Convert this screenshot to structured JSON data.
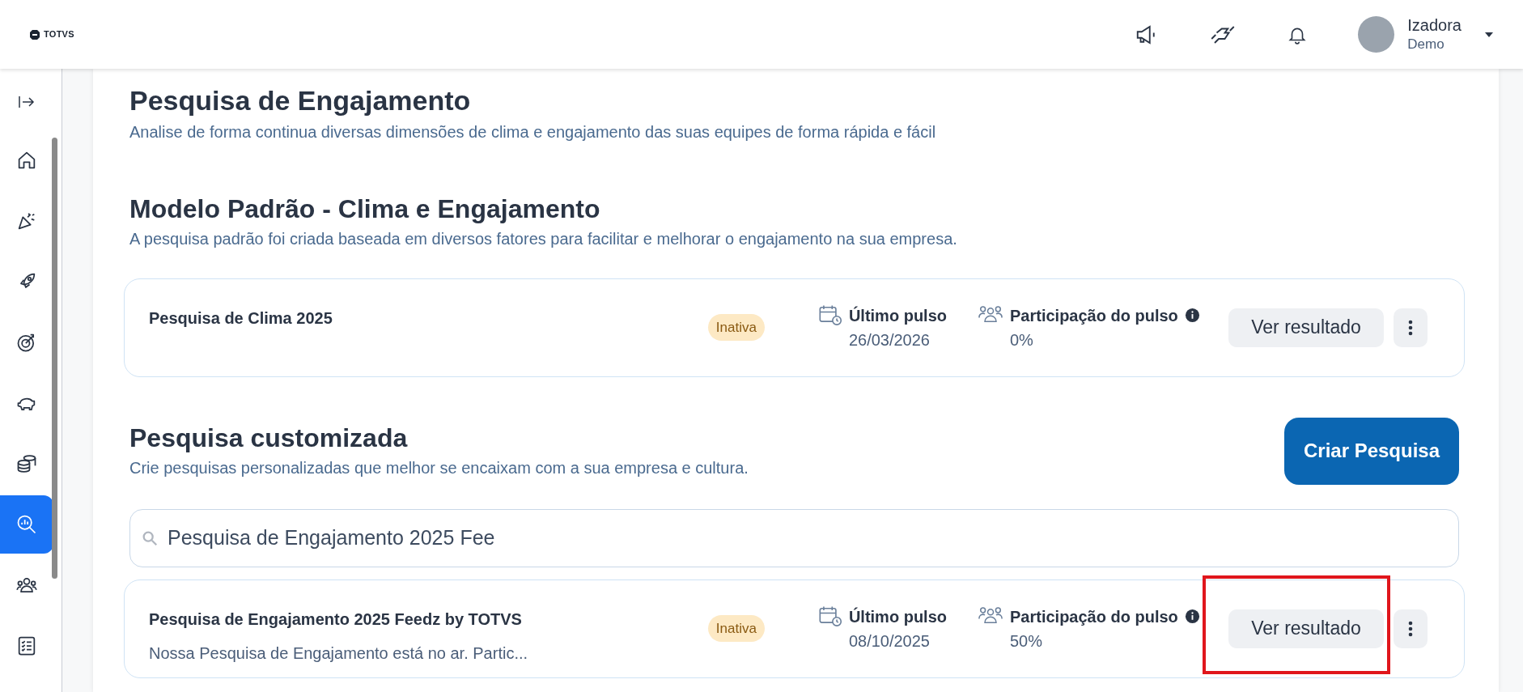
{
  "header": {
    "logo": "TOTVS",
    "user": {
      "name": "Izadora",
      "role": "Demo"
    }
  },
  "sidebar": {
    "items": [
      {
        "selected": false
      },
      {
        "selected": false
      },
      {
        "selected": false
      },
      {
        "selected": false
      },
      {
        "selected": false
      },
      {
        "selected": false
      },
      {
        "selected": true
      },
      {
        "selected": false
      },
      {
        "selected": false
      }
    ]
  },
  "page": {
    "title": "Pesquisa de Engajamento",
    "subtitle": "Analise de forma continua diversas dimensões de clima e engajamento das suas equipes de forma rápida e fácil"
  },
  "default_section": {
    "title": "Modelo Padrão - Clima e Engajamento",
    "subtitle": "A pesquisa padrão foi criada baseada em diversos fatores para facilitar e melhorar o engajamento na sua empresa.",
    "surveys": [
      {
        "name": "Pesquisa de Clima 2025",
        "status": "Inativa",
        "last_pulse_label": "Último pulso",
        "last_pulse": "26/03/2026",
        "participation_label": "Participação do pulso",
        "participation": "0%",
        "action": "Ver resultado",
        "highlighted": false
      }
    ]
  },
  "custom_section": {
    "title": "Pesquisa customizada",
    "subtitle": "Crie pesquisas personalizadas que melhor se encaixam com a sua empresa e cultura.",
    "create_button": "Criar Pesquisa",
    "search": {
      "value": "Pesquisa de Engajamento 2025 Fee"
    },
    "surveys": [
      {
        "name": "Pesquisa de Engajamento 2025 Feedz by TOTVS",
        "description": "Nossa Pesquisa de Engajamento está no ar. Partic...",
        "status": "Inativa",
        "last_pulse_label": "Último pulso",
        "last_pulse": "08/10/2025",
        "participation_label": "Participação do pulso",
        "participation": "50%",
        "action": "Ver resultado",
        "highlighted": true
      }
    ]
  }
}
